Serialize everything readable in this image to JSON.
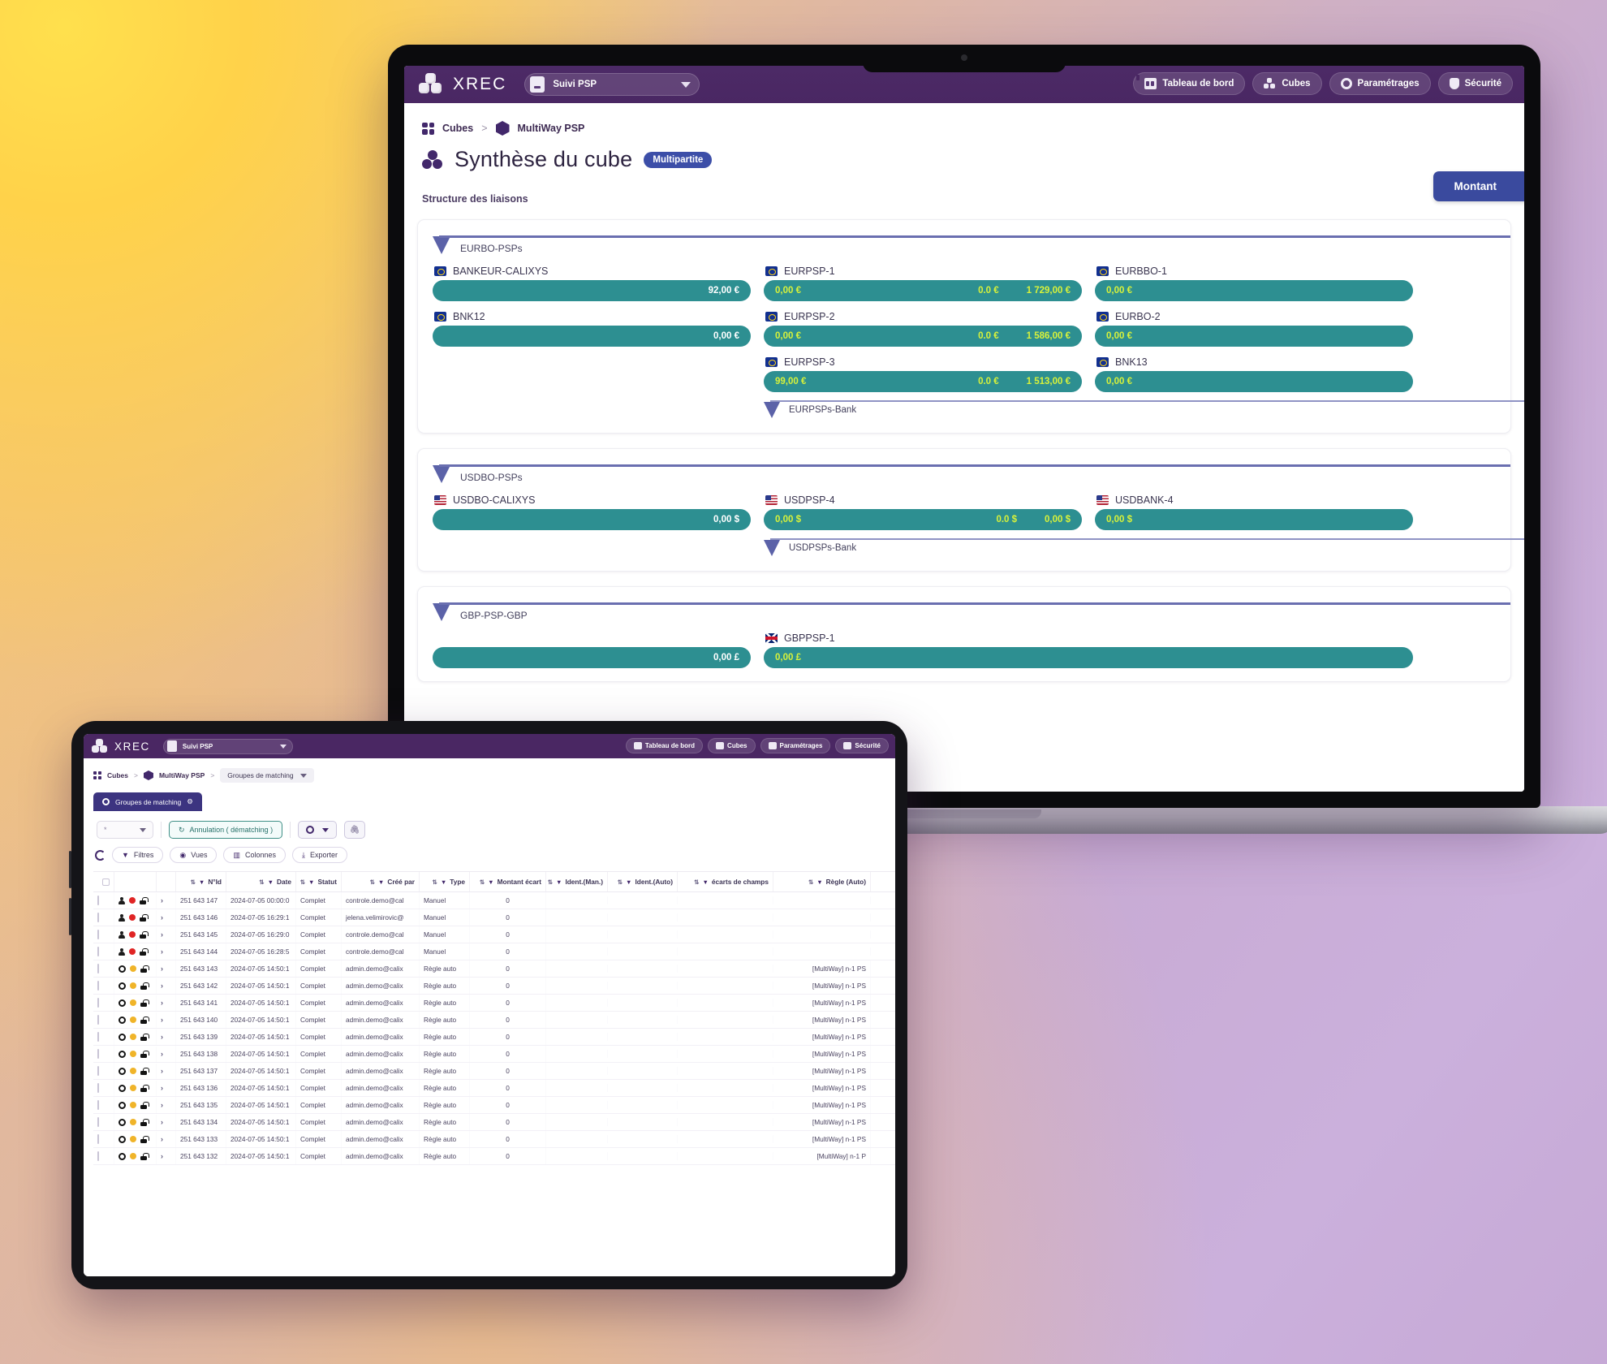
{
  "app": {
    "brand": "XREC",
    "context_select": "Suivi PSP",
    "topnav": [
      {
        "label": "Tableau de bord",
        "icon": "dashboard-icon"
      },
      {
        "label": "Cubes",
        "icon": "cubes-icon"
      },
      {
        "label": "Paramétrages",
        "icon": "gear-icon"
      },
      {
        "label": "Sécurité",
        "icon": "shield-icon"
      }
    ]
  },
  "laptop": {
    "breadcrumb": {
      "root": "Cubes",
      "separator": ">",
      "current": "MultiWay PSP"
    },
    "page_title": "Synthèse du cube",
    "badge": "Multipartite",
    "section_label": "Structure des liaisons",
    "montant_button": "Montant",
    "groups": [
      {
        "name": "EURBO-PSPs",
        "columns": [
          {
            "nodes": [
              {
                "flag": "eu",
                "label": "BANKEUR-CALIXYS",
                "left": "",
                "mid": "",
                "right": "92,00 €"
              },
              {
                "flag": "eu",
                "label": "BNK12",
                "left": "",
                "mid": "",
                "right": "0,00 €"
              }
            ]
          },
          {
            "nodes": [
              {
                "flag": "eu",
                "label": "EURPSP-1",
                "left": "0,00 €",
                "mid": "0.0 €",
                "right": "1 729,00 €"
              },
              {
                "flag": "eu",
                "label": "EURPSP-2",
                "left": "0,00 €",
                "mid": "0.0 €",
                "right": "1 586,00 €"
              },
              {
                "flag": "eu",
                "label": "EURPSP-3",
                "left": "99,00 €",
                "mid": "0.0 €",
                "right": "1 513,00 €"
              }
            ],
            "subgroup": "EURPSPs-Bank"
          },
          {
            "nodes": [
              {
                "flag": "eu",
                "label": "EURBBO-1",
                "left": "0,00 €",
                "mid": "",
                "right": ""
              },
              {
                "flag": "eu",
                "label": "EURBO-2",
                "left": "0,00 €",
                "mid": "",
                "right": ""
              },
              {
                "flag": "eu",
                "label": "BNK13",
                "left": "0,00 €",
                "mid": "",
                "right": ""
              }
            ]
          }
        ]
      },
      {
        "name": "USDBO-PSPs",
        "columns": [
          {
            "nodes": [
              {
                "flag": "us",
                "label": "USDBO-CALIXYS",
                "left": "",
                "mid": "",
                "right": "0,00 $"
              }
            ]
          },
          {
            "nodes": [
              {
                "flag": "us",
                "label": "USDPSP-4",
                "left": "0,00 $",
                "mid": "0.0 $",
                "right": "0,00 $"
              }
            ],
            "subgroup": "USDPSPs-Bank"
          },
          {
            "nodes": [
              {
                "flag": "us",
                "label": "USDBANK-4",
                "left": "0,00 $",
                "mid": "",
                "right": ""
              }
            ]
          }
        ]
      },
      {
        "name": "GBP-PSP-GBP",
        "columns": [
          {
            "nodes": [
              {
                "flag": "gb",
                "label": "",
                "left": "",
                "mid": "",
                "right": "0,00 £"
              }
            ]
          },
          {
            "nodes": [
              {
                "flag": "gb",
                "label": "GBPPSP-1",
                "left": "0,00 £",
                "mid": "",
                "right": ""
              }
            ]
          }
        ]
      }
    ]
  },
  "tablet": {
    "breadcrumb": {
      "root": "Cubes",
      "separator": ">",
      "mid": "MultiWay PSP",
      "current": "Groupes de matching"
    },
    "active_tab": "Groupes de matching",
    "toolbar": {
      "select_value": "*",
      "annulation_button": "Annulation ( dématching )",
      "gear_button": "",
      "clip_button": ""
    },
    "toolbar2": [
      {
        "label": "Filtres",
        "icon": "filter-icon"
      },
      {
        "label": "Vues",
        "icon": "eye-icon"
      },
      {
        "label": "Colonnes",
        "icon": "columns-icon"
      },
      {
        "label": "Exporter",
        "icon": "download-icon"
      }
    ],
    "table": {
      "headers": [
        "N°Id",
        "Date",
        "Statut",
        "Créé par",
        "Type",
        "Montant écart",
        "Ident.(Man.)",
        "Ident.(Auto)",
        "écarts de champs",
        "Règle (Auto)"
      ],
      "rows": [
        {
          "icons": "person",
          "dot": "red",
          "id": "251 643 147",
          "date": "2024-07-05 00:00:0",
          "statut": "Complet",
          "cree": "controle.demo@cal",
          "type": "Manuel",
          "montant": "0",
          "identm": "",
          "identa": "",
          "ecarts": "",
          "regle": ""
        },
        {
          "icons": "person",
          "dot": "red",
          "id": "251 643 146",
          "date": "2024-07-05 16:29:1",
          "statut": "Complet",
          "cree": "jelena.velimirovic@",
          "type": "Manuel",
          "montant": "0",
          "identm": "",
          "identa": "",
          "ecarts": "",
          "regle": ""
        },
        {
          "icons": "person",
          "dot": "red",
          "id": "251 643 145",
          "date": "2024-07-05 16:29:0",
          "statut": "Complet",
          "cree": "controle.demo@cal",
          "type": "Manuel",
          "montant": "0",
          "identm": "",
          "identa": "",
          "ecarts": "",
          "regle": ""
        },
        {
          "icons": "person",
          "dot": "red",
          "id": "251 643 144",
          "date": "2024-07-05 16:28:5",
          "statut": "Complet",
          "cree": "controle.demo@cal",
          "type": "Manuel",
          "montant": "0",
          "identm": "",
          "identa": "",
          "ecarts": "",
          "regle": ""
        },
        {
          "icons": "gear",
          "dot": "amber",
          "id": "251 643 143",
          "date": "2024-07-05 14:50:1",
          "statut": "Complet",
          "cree": "admin.demo@calix",
          "type": "Règle auto",
          "montant": "0",
          "identm": "",
          "identa": "",
          "ecarts": "",
          "regle": "[MultiWay] n-1 PS"
        },
        {
          "icons": "gear",
          "dot": "amber",
          "id": "251 643 142",
          "date": "2024-07-05 14:50:1",
          "statut": "Complet",
          "cree": "admin.demo@calix",
          "type": "Règle auto",
          "montant": "0",
          "identm": "",
          "identa": "",
          "ecarts": "",
          "regle": "[MultiWay] n-1 PS"
        },
        {
          "icons": "gear",
          "dot": "amber",
          "id": "251 643 141",
          "date": "2024-07-05 14:50:1",
          "statut": "Complet",
          "cree": "admin.demo@calix",
          "type": "Règle auto",
          "montant": "0",
          "identm": "",
          "identa": "",
          "ecarts": "",
          "regle": "[MultiWay] n-1 PS"
        },
        {
          "icons": "gear",
          "dot": "amber",
          "id": "251 643 140",
          "date": "2024-07-05 14:50:1",
          "statut": "Complet",
          "cree": "admin.demo@calix",
          "type": "Règle auto",
          "montant": "0",
          "identm": "",
          "identa": "",
          "ecarts": "",
          "regle": "[MultiWay] n-1 PS"
        },
        {
          "icons": "gear",
          "dot": "amber",
          "id": "251 643 139",
          "date": "2024-07-05 14:50:1",
          "statut": "Complet",
          "cree": "admin.demo@calix",
          "type": "Règle auto",
          "montant": "0",
          "identm": "",
          "identa": "",
          "ecarts": "",
          "regle": "[MultiWay] n-1 PS"
        },
        {
          "icons": "gear",
          "dot": "amber",
          "id": "251 643 138",
          "date": "2024-07-05 14:50:1",
          "statut": "Complet",
          "cree": "admin.demo@calix",
          "type": "Règle auto",
          "montant": "0",
          "identm": "",
          "identa": "",
          "ecarts": "",
          "regle": "[MultiWay] n-1 PS"
        },
        {
          "icons": "gear",
          "dot": "amber",
          "id": "251 643 137",
          "date": "2024-07-05 14:50:1",
          "statut": "Complet",
          "cree": "admin.demo@calix",
          "type": "Règle auto",
          "montant": "0",
          "identm": "",
          "identa": "",
          "ecarts": "",
          "regle": "[MultiWay] n-1 PS"
        },
        {
          "icons": "gear",
          "dot": "amber",
          "id": "251 643 136",
          "date": "2024-07-05 14:50:1",
          "statut": "Complet",
          "cree": "admin.demo@calix",
          "type": "Règle auto",
          "montant": "0",
          "identm": "",
          "identa": "",
          "ecarts": "",
          "regle": "[MultiWay] n-1 PS"
        },
        {
          "icons": "gear",
          "dot": "amber",
          "id": "251 643 135",
          "date": "2024-07-05 14:50:1",
          "statut": "Complet",
          "cree": "admin.demo@calix",
          "type": "Règle auto",
          "montant": "0",
          "identm": "",
          "identa": "",
          "ecarts": "",
          "regle": "[MultiWay] n-1 PS"
        },
        {
          "icons": "gear",
          "dot": "amber",
          "id": "251 643 134",
          "date": "2024-07-05 14:50:1",
          "statut": "Complet",
          "cree": "admin.demo@calix",
          "type": "Règle auto",
          "montant": "0",
          "identm": "",
          "identa": "",
          "ecarts": "",
          "regle": "[MultiWay] n-1 PS"
        },
        {
          "icons": "gear",
          "dot": "amber",
          "id": "251 643 133",
          "date": "2024-07-05 14:50:1",
          "statut": "Complet",
          "cree": "admin.demo@calix",
          "type": "Règle auto",
          "montant": "0",
          "identm": "",
          "identa": "",
          "ecarts": "",
          "regle": "[MultiWay] n-1 PS"
        },
        {
          "icons": "gear",
          "dot": "amber",
          "id": "251 643 132",
          "date": "2024-07-05 14:50:1",
          "statut": "Complet",
          "cree": "admin.demo@calix",
          "type": "Règle auto",
          "montant": "0",
          "identm": "",
          "identa": "",
          "ecarts": "",
          "regle": "[MultiWay] n-1 P"
        }
      ]
    }
  },
  "colors": {
    "brand_purple": "#4a2763",
    "accent_teal": "#2d8f91",
    "accent_lime": "#d8f23a",
    "indigo": "#3a4a9e",
    "group_blue": "#5b62a8"
  }
}
